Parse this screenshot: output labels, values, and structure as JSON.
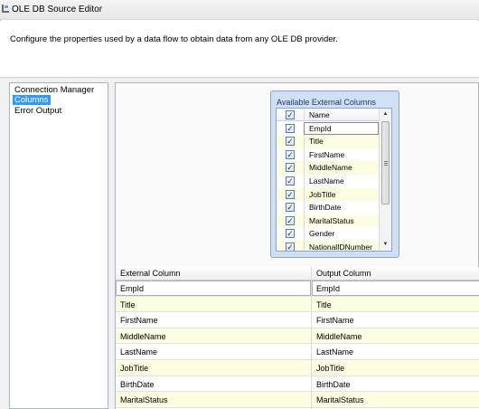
{
  "window": {
    "title": "OLE DB Source Editor"
  },
  "description": "Configure the properties used by a data flow to obtain data from any OLE DB provider.",
  "nav": {
    "items": [
      {
        "label": "Connection Manager",
        "selected": false
      },
      {
        "label": "Columns",
        "selected": true
      },
      {
        "label": "Error Output",
        "selected": false
      }
    ]
  },
  "available_columns": {
    "title": "Available External Columns",
    "header": "Name",
    "items": [
      {
        "name": "EmpId",
        "checked": true
      },
      {
        "name": "Title",
        "checked": true
      },
      {
        "name": "FirstName",
        "checked": true
      },
      {
        "name": "MiddleName",
        "checked": true
      },
      {
        "name": "LastName",
        "checked": true
      },
      {
        "name": "JobTitle",
        "checked": true
      },
      {
        "name": "BirthDate",
        "checked": true
      },
      {
        "name": "MaritalStatus",
        "checked": true
      },
      {
        "name": "Gender",
        "checked": true
      },
      {
        "name": "NationalIDNumber",
        "checked": true
      }
    ]
  },
  "mapping": {
    "headers": {
      "external": "External Column",
      "output": "Output Column"
    },
    "rows": [
      {
        "external": "EmpId",
        "output": "EmpId"
      },
      {
        "external": "Title",
        "output": "Title"
      },
      {
        "external": "FirstName",
        "output": "FirstName"
      },
      {
        "external": "MiddleName",
        "output": "MiddleName"
      },
      {
        "external": "LastName",
        "output": "LastName"
      },
      {
        "external": "JobTitle",
        "output": "JobTitle"
      },
      {
        "external": "BirthDate",
        "output": "BirthDate"
      },
      {
        "external": "MaritalStatus",
        "output": "MaritalStatus"
      }
    ]
  },
  "icons": {
    "checkbox": "checkbox-checked-icon",
    "scroll_up": "scroll-up-arrow-icon",
    "scroll_down": "scroll-down-arrow-icon"
  },
  "glyphs": {
    "check": "✓",
    "up": "▲",
    "down": "▼"
  }
}
